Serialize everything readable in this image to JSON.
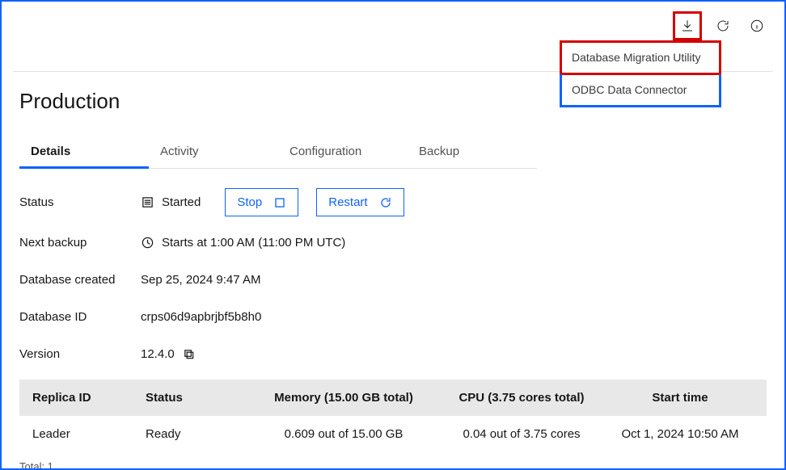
{
  "topbar": {
    "download_icon": "download-icon",
    "refresh_icon": "refresh-icon",
    "info_icon": "info-icon"
  },
  "dropdown": {
    "item1": "Database Migration Utility",
    "item2": "ODBC Data Connector"
  },
  "page": {
    "title": "Production"
  },
  "tabs": {
    "details": "Details",
    "activity": "Activity",
    "configuration": "Configuration",
    "backup": "Backup"
  },
  "details": {
    "status_label": "Status",
    "status_value": "Started",
    "stop_btn": "Stop",
    "restart_btn": "Restart",
    "next_backup_label": "Next backup",
    "next_backup_value": "Starts at 1:00 AM (11:00 PM UTC)",
    "db_created_label": "Database created",
    "db_created_value": "Sep 25, 2024 9:47 AM",
    "db_id_label": "Database ID",
    "db_id_value": "crps06d9apbrjbf5b8h0",
    "version_label": "Version",
    "version_value": "12.4.0"
  },
  "table": {
    "headers": {
      "replica_id": "Replica ID",
      "status": "Status",
      "memory": "Memory (15.00 GB total)",
      "cpu": "CPU (3.75 cores total)",
      "start_time": "Start time"
    },
    "row": {
      "replica_id": "Leader",
      "status": "Ready",
      "memory": "0.609 out of 15.00 GB",
      "cpu": "0.04 out of 3.75 cores",
      "start_time": "Oct 1, 2024 10:50 AM"
    },
    "total": "Total: 1"
  }
}
